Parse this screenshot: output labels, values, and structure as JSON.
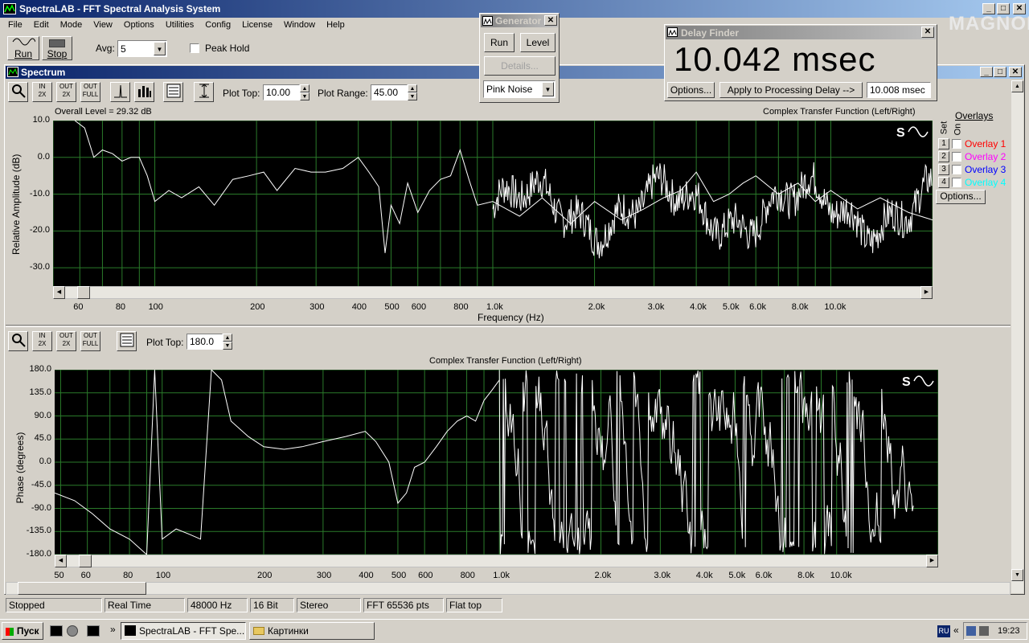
{
  "app": {
    "title": "SpectraLAB - FFT Spectral Analysis System",
    "menu": [
      "File",
      "Edit",
      "Mode",
      "View",
      "Options",
      "Utilities",
      "Config",
      "License",
      "Window",
      "Help"
    ]
  },
  "toolbar": {
    "run_label": "Run",
    "stop_label": "Stop",
    "avg_label": "Avg:",
    "avg_value": "5",
    "peak_hold_label": "Peak Hold"
  },
  "spectrum_window": {
    "title": "Spectrum",
    "plot_top_label": "Plot Top:",
    "plot_top_value": "10.00",
    "plot_range_label": "Plot Range:",
    "plot_range_value": "45.00",
    "overall_level": "Overall Level = 29.32 dB",
    "graph_title": "Complex Transfer Function (Left/Right)",
    "ylabel": "Relative Amplitude (dB)",
    "xlabel": "Frequency (Hz)",
    "overlays_label": "Overlays",
    "set_label": "Set",
    "on_label": "On",
    "overlays": [
      {
        "num": "1",
        "name": "Overlay 1",
        "color": "#ff0000"
      },
      {
        "num": "2",
        "name": "Overlay 2",
        "color": "#ff00ff"
      },
      {
        "num": "3",
        "name": "Overlay 3",
        "color": "#0000ff"
      },
      {
        "num": "4",
        "name": "Overlay 4",
        "color": "#00ffff"
      }
    ],
    "options_label": "Options..."
  },
  "phase_panel": {
    "plot_top_label": "Plot Top:",
    "plot_top_value": "180.0",
    "graph_title": "Complex Transfer Function (Left/Right)",
    "ylabel": "Phase (degrees)"
  },
  "generator": {
    "title": "Generator",
    "run_label": "Run",
    "level_label": "Level",
    "details_label": "Details...",
    "signal_value": "Pink Noise"
  },
  "delay_finder": {
    "title": "Delay Finder",
    "value": "10.042 msec",
    "options_label": "Options...",
    "apply_label": "Apply to Processing Delay -->",
    "applied_value": "10.008 msec"
  },
  "status_bar": [
    "Stopped",
    "Real Time",
    "48000 Hz",
    "16 Bit",
    "Stereo",
    "FFT 65536 pts",
    "Flat top"
  ],
  "taskbar": {
    "start_label": "Пуск",
    "task1": "SpectraLAB - FFT Spe...",
    "task2": "Картинки",
    "lang": "RU",
    "clock": "19:23"
  },
  "watermark": "MAGNOLA",
  "chart_data": [
    {
      "type": "line",
      "title": "Complex Transfer Function (Left/Right)",
      "xlabel": "Frequency (Hz)",
      "ylabel": "Relative Amplitude (dB)",
      "xscale": "log",
      "xlim": [
        50,
        20000
      ],
      "ylim": [
        -35,
        10
      ],
      "yticks": [
        "10.0",
        "0.0",
        "-10.0",
        "-20.0",
        "-30.0"
      ],
      "xticks": [
        "60",
        "80",
        "100",
        "200",
        "300",
        "400",
        "500",
        "600",
        "800",
        "1.0k",
        "2.0k",
        "3.0k",
        "4.0k",
        "5.0k",
        "6.0k",
        "8.0k",
        "10.0k"
      ],
      "grid": true,
      "series": [
        {
          "x": [
            58,
            62,
            66,
            70,
            75,
            80,
            85,
            90,
            95,
            100,
            110,
            120,
            135,
            150,
            170,
            190,
            210,
            230,
            260,
            290,
            320,
            360,
            400,
            430,
            460,
            480,
            500,
            530,
            560,
            600,
            650,
            700,
            750,
            800,
            850,
            900,
            1000,
            1200,
            1400,
            1700,
            2000,
            2400,
            2800,
            3200,
            3600,
            4000,
            4500,
            5000,
            5500,
            6000,
            7000,
            8000,
            9000,
            10000,
            12000,
            14000,
            17000,
            20000
          ],
          "values": [
            10,
            8,
            0,
            2,
            1,
            -1,
            0,
            0,
            -5,
            -12,
            -9,
            -11,
            -8,
            -13,
            -6,
            -5,
            -4,
            -9,
            -3,
            -4,
            -4,
            -3,
            0,
            -4,
            -8,
            -26,
            -13,
            -18,
            -7,
            -15,
            -9,
            -6,
            -5,
            2,
            -6,
            -13,
            -12,
            -16,
            -11,
            -18,
            -12,
            -17,
            -14,
            -11,
            -9,
            -4,
            -12,
            -10,
            -7,
            -5,
            -10,
            -7,
            -12,
            -9,
            -14,
            -11,
            -15,
            -17
          ]
        }
      ]
    },
    {
      "type": "line",
      "title": "Complex Transfer Function (Left/Right)",
      "ylabel": "Phase (degrees)",
      "xscale": "log",
      "xlim": [
        48,
        20000
      ],
      "ylim": [
        -180,
        180
      ],
      "yticks": [
        "180.0",
        "135.0",
        "90.0",
        "45.0",
        "0.0",
        "-45.0",
        "-90.0",
        "-135.0",
        "-180.0"
      ],
      "xticks": [
        "50",
        "60",
        "80",
        "100",
        "200",
        "300",
        "400",
        "500",
        "600",
        "800",
        "1.0k",
        "2.0k",
        "3.0k",
        "4.0k",
        "5.0k",
        "6.0k",
        "8.0k",
        "10.0k"
      ],
      "grid": true,
      "series": [
        {
          "x": [
            48,
            55,
            62,
            70,
            80,
            90,
            95,
            100,
            110,
            120,
            130,
            140,
            150,
            160,
            180,
            200,
            230,
            260,
            300,
            350,
            400,
            430,
            470,
            500,
            530,
            560,
            600,
            650,
            700,
            750,
            800,
            850,
            900,
            950,
            1000
          ],
          "values": [
            -60,
            -75,
            -100,
            -130,
            -150,
            -180,
            180,
            -150,
            -130,
            -140,
            -150,
            180,
            160,
            80,
            50,
            30,
            25,
            30,
            40,
            50,
            60,
            40,
            0,
            -80,
            -60,
            -10,
            0,
            30,
            60,
            80,
            90,
            80,
            120,
            140,
            160
          ]
        }
      ]
    }
  ]
}
